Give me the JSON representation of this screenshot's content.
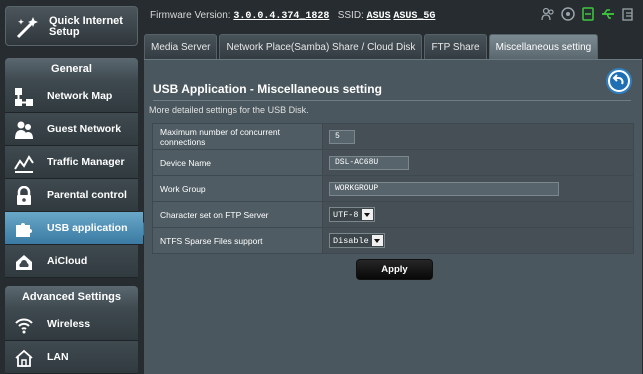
{
  "sidebar": {
    "quick_setup": "Quick Internet Setup",
    "general_header": "General",
    "general_items": [
      {
        "label": "Network Map",
        "icon": "network-map-icon"
      },
      {
        "label": "Guest Network",
        "icon": "guest-network-icon"
      },
      {
        "label": "Traffic Manager",
        "icon": "traffic-manager-icon"
      },
      {
        "label": "Parental control",
        "icon": "lock-icon"
      },
      {
        "label": "USB application",
        "icon": "puzzle-icon",
        "active": true
      },
      {
        "label": "AiCloud",
        "icon": "cloud-icon"
      }
    ],
    "advanced_header": "Advanced Settings",
    "advanced_items": [
      {
        "label": "Wireless",
        "icon": "wifi-icon"
      },
      {
        "label": "LAN",
        "icon": "home-icon"
      }
    ]
  },
  "topbar": {
    "firmware_label": "Firmware Version:",
    "firmware_value": "3.0.0.4.374_1828",
    "ssid_label": "SSID:",
    "ssid_1": "ASUS",
    "ssid_2": "ASUS_5G"
  },
  "tabs": [
    {
      "label": "Media Server"
    },
    {
      "label": "Network Place(Samba) Share / Cloud Disk"
    },
    {
      "label": "FTP Share"
    },
    {
      "label": "Miscellaneous setting",
      "active": true
    }
  ],
  "main": {
    "title": "USB Application - Miscellaneous setting",
    "description": "More detailed settings for the USB Disk.",
    "rows": [
      {
        "label": "Maximum number of concurrent connections",
        "value": "5"
      },
      {
        "label": "Device Name",
        "value": "DSL-AC68U"
      },
      {
        "label": "Work Group",
        "value": "WORKGROUP"
      },
      {
        "label": "Character set on FTP Server",
        "value": "UTF-8"
      },
      {
        "label": "NTFS Sparse Files support",
        "value": "Disable"
      }
    ],
    "apply_label": "Apply"
  },
  "colors": {
    "active_menu": "#3a7aa3",
    "status_green": "#3fc83f",
    "back_button": "#1f6fb4"
  }
}
